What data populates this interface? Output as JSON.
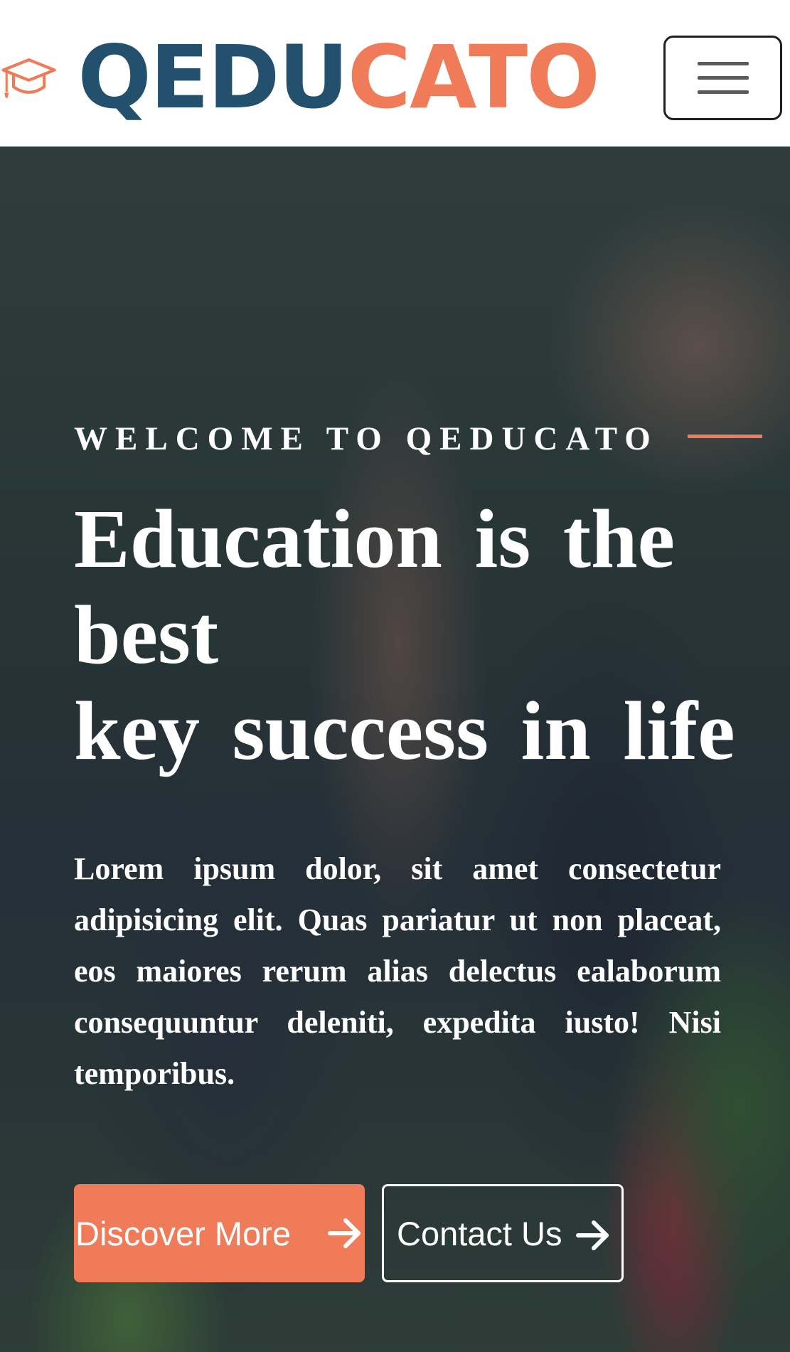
{
  "header": {
    "logo_part1": "QEDU",
    "logo_part2": "CATO",
    "logo_icon": "graduation-cap-icon",
    "menu_icon": "hamburger-menu-icon"
  },
  "hero": {
    "kicker": "WELCOME TO QEDUCATO",
    "headline_line1": "Education is the best",
    "headline_line2": "key success in life",
    "lead": "Lorem ipsum dolor, sit amet consectetur adipisicing elit. Quas pariatur ut non placeat, eos maiores rerum alias delectus ealaborum consequuntur deleniti, expedita iusto! Nisi temporibus.",
    "primary_button": "Discover More",
    "secondary_button": "Contact Us",
    "arrow_icon": "arrow-right-icon",
    "background": "graduates-high-five-photo"
  },
  "colors": {
    "brand_blue": "#23506d",
    "brand_orange": "#ef7b58",
    "text_on_hero": "#ffffff"
  }
}
